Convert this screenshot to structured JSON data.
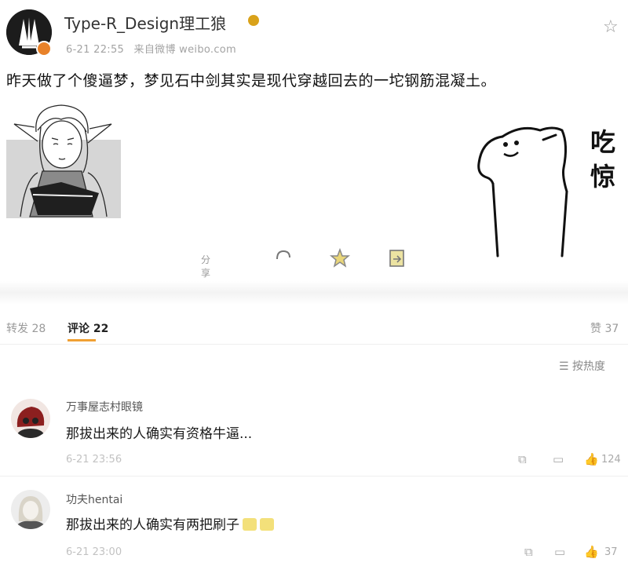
{
  "post": {
    "author": "Type-R_Design理工狼",
    "time": "6-21 22:55",
    "source": "来自微博 weibo.com",
    "text": "昨天做了个傻逼梦，梦见石中剑其实是现代穿越回去的一坨钢筋混凝土。",
    "sticker_text": [
      "吃",
      "惊"
    ],
    "share_label": "分享到"
  },
  "tabs": {
    "repost": "转发 28",
    "comments": "评论 22",
    "likes": "赞 37",
    "sort": "按热度"
  },
  "comments": [
    {
      "name": "万事屋志村眼镜",
      "text": "那拔出来的人确实有资格牛逼...",
      "time": "6-21 23:56",
      "likes": "124"
    },
    {
      "name": "功夫hentai",
      "text": "那拔出来的人确实有两把刷子",
      "time": "6-21 23:00",
      "likes": "37"
    }
  ],
  "colors": {
    "accent": "#e8822a",
    "text": "#222222",
    "muted": "#9a9a9a"
  },
  "icons": [
    "author-avatar",
    "verified-badge",
    "star-icon",
    "comment-icon",
    "share-icon",
    "like-icon",
    "sort-icon"
  ]
}
